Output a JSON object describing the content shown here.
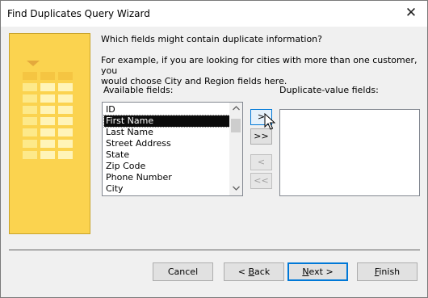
{
  "window": {
    "title": "Find Duplicates Query Wizard",
    "close_glyph": "✕"
  },
  "prompt": "Which fields might contain duplicate information?",
  "example_line1": "For example, if you are looking for cities with more than one customer, you",
  "example_line2": "would choose City and Region fields here.",
  "available_label": "Available fields:",
  "duplicate_label": "Duplicate-value fields:",
  "available_fields": [
    "ID",
    "First Name",
    "Last Name",
    "Street Address",
    "State",
    "Zip Code",
    "Phone Number",
    "City"
  ],
  "selected_field": "First Name",
  "duplicate_fields": [],
  "move_buttons": {
    "add": ">",
    "add_all": ">>",
    "remove": "<",
    "remove_all": "<<"
  },
  "buttons": {
    "cancel": "Cancel",
    "back_prefix": "< ",
    "back_key": "B",
    "back_rest": "ack",
    "next_key": "N",
    "next_rest": "ext >",
    "finish_key": "F",
    "finish_rest": "inish"
  },
  "icons": {
    "scroll_up": "scroll-up-arrow-icon",
    "scroll_down": "scroll-down-arrow-icon",
    "cursor": "mouse-pointer-icon"
  },
  "colors": {
    "art_bg": "#fbd34f",
    "selection": "#0b0b0b",
    "default_button_border": "#0078d7"
  }
}
